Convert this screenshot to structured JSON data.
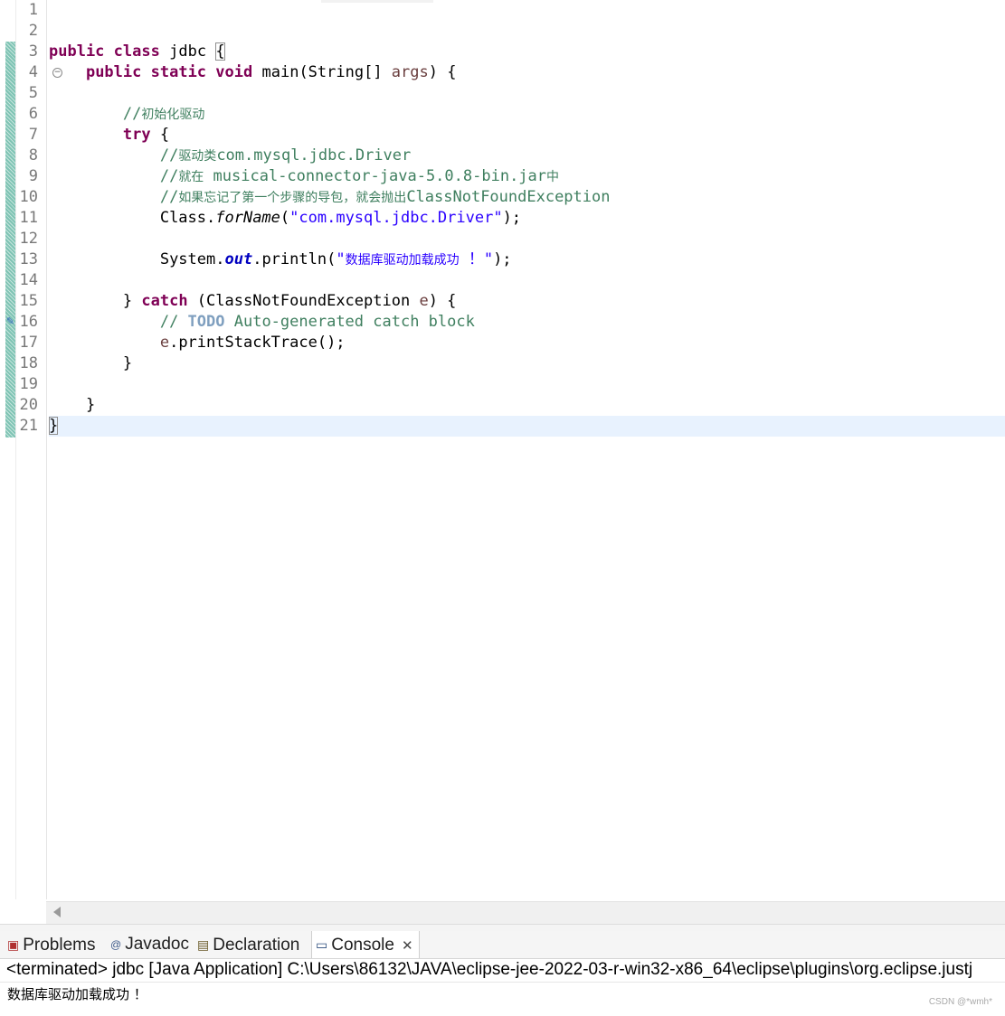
{
  "editor": {
    "line_numbers": [
      "1",
      "2",
      "3",
      "4",
      "5",
      "6",
      "7",
      "8",
      "9",
      "10",
      "11",
      "12",
      "13",
      "14",
      "15",
      "16",
      "17",
      "18",
      "19",
      "20",
      "21"
    ],
    "fold_icon": "collapse-icon",
    "task_marker_icon": "task-marker-icon",
    "code": {
      "l3_kw1": "public",
      "l3_kw2": "class",
      "l3_name": "jdbc",
      "l3_brace": "{",
      "l4_kw1": "public",
      "l4_kw2": "static",
      "l4_kw3": "void",
      "l4_sig": "main(String[] ",
      "l4_param": "args",
      "l4_end": ") {",
      "l6_comment_a": "//",
      "l6_comment_b": "初始化驱动",
      "l7_kw": "try",
      "l7_end": " {",
      "l8_comment_a": "//",
      "l8_comment_b": "驱动类",
      "l8_comment_c": "com.mysql.jdbc.Driver",
      "l9_comment_a": "//",
      "l9_comment_b": "就在",
      "l9_comment_c": " musical-connector-java-5.0.8-bin.jar",
      "l9_comment_d": "中",
      "l10_comment_a": "//",
      "l10_comment_b": "如果忘记了第一个步骤的导包，就会抛出",
      "l10_comment_c": "ClassNotFoundException",
      "l11_a": "Class.",
      "l11_method": "forName",
      "l11_b": "(",
      "l11_str": "\"com.mysql.jdbc.Driver\"",
      "l11_c": ");",
      "l13_a": "System.",
      "l13_field": "out",
      "l13_b": ".println(",
      "l13_str_a": "\"",
      "l13_str_b": "数据库驱动加载成功",
      "l13_str_c": " ！\"",
      "l13_c": ");",
      "l15_a": "} ",
      "l15_kw": "catch",
      "l15_b": " (ClassNotFoundException ",
      "l15_param": "e",
      "l15_c": ") {",
      "l16_comment_a": "// ",
      "l16_todo": "TODO",
      "l16_comment_b": " Auto-generated catch block",
      "l17_param": "e",
      "l17_rest": ".printStackTrace();",
      "l18": "}",
      "l20": "}",
      "l21": "}"
    }
  },
  "views": {
    "tabs": [
      {
        "label": "Problems",
        "icon": "problems-icon"
      },
      {
        "label": "Javadoc",
        "icon": "javadoc-icon"
      },
      {
        "label": "Declaration",
        "icon": "declaration-icon"
      },
      {
        "label": "Console",
        "icon": "console-icon",
        "active": true
      }
    ],
    "close_glyph": "✕"
  },
  "console": {
    "header": "<terminated> jdbc [Java Application] C:\\Users\\86132\\JAVA\\eclipse-jee-2022-03-r-win32-x86_64\\eclipse\\plugins\\org.eclipse.justj",
    "output": "数据库驱动加载成功 ！"
  },
  "watermark": "CSDN @*wmh*"
}
